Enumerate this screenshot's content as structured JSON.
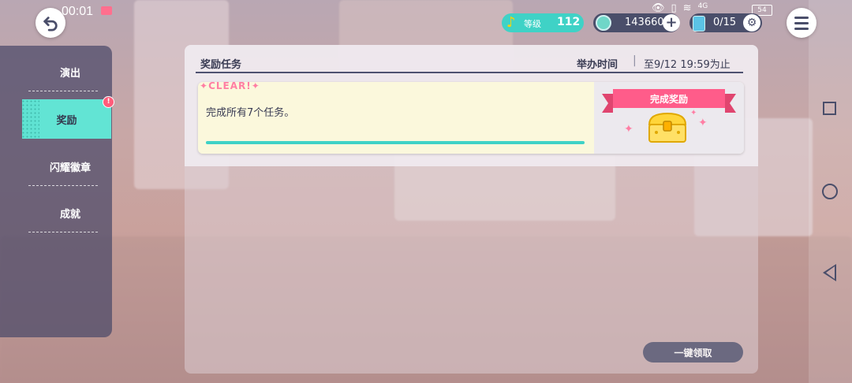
{
  "status_bar": {
    "time": "00:01",
    "signal_label": "4G",
    "battery": "54"
  },
  "top_bar": {
    "level_label": "等级",
    "level_value": "112",
    "currency_value": "143660",
    "energy_value": "0/15"
  },
  "sidebar": {
    "items": [
      {
        "label": "演出"
      },
      {
        "label": "奖励",
        "active": true,
        "badge": "!"
      },
      {
        "label": "闪耀徽章"
      },
      {
        "label": "成就"
      }
    ]
  },
  "panel": {
    "title": "奖励任务",
    "period_label": "举办时间",
    "period_value": "至9/12 19:59为止"
  },
  "missions": [
    {
      "clear_label": "CLEAR!",
      "text": "完成所有7个任务。",
      "progress": 1.0,
      "reward_label": "完成奖励"
    }
  ],
  "footer": {
    "claim_all_label": "一键领取"
  },
  "colors": {
    "accent": "#3fd2c6",
    "pink": "#ff5c8a",
    "dark": "#4a4e6a"
  }
}
